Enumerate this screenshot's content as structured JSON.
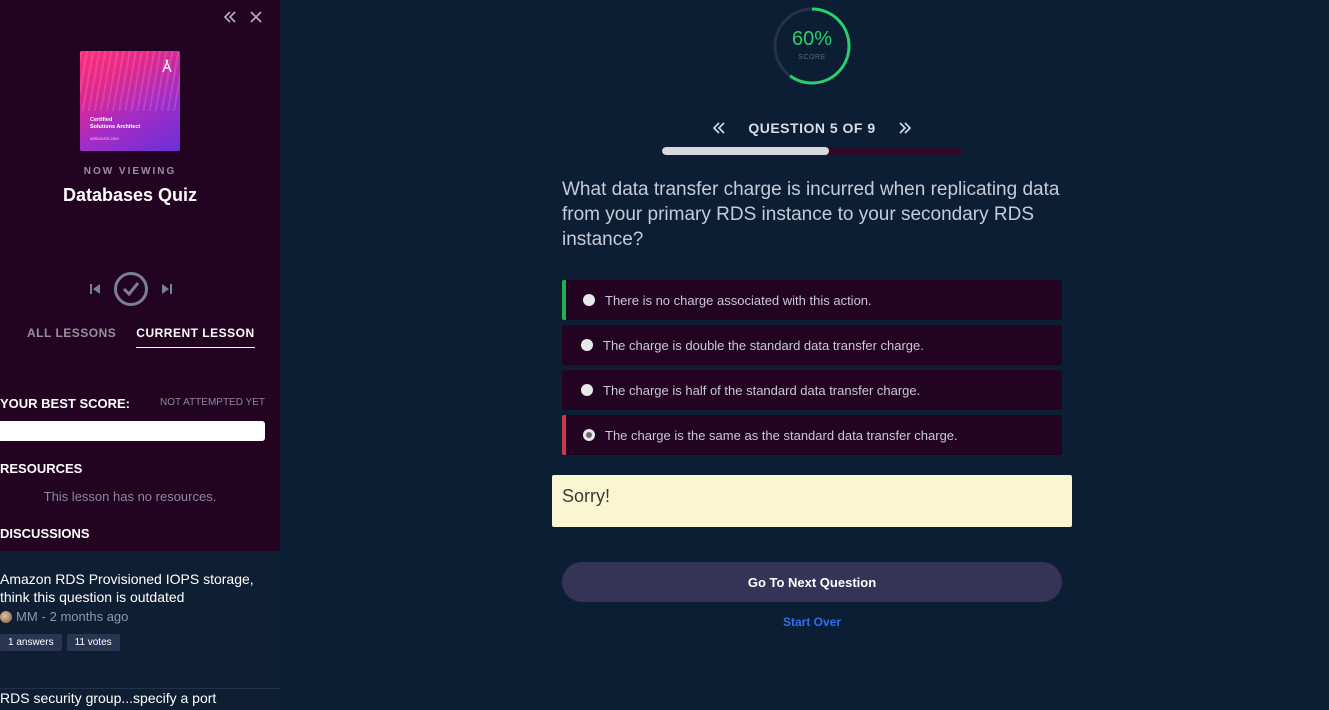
{
  "sidebar": {
    "cover": {
      "title_line1": "Certified",
      "title_line2": "Solutions Architect",
      "subtitle": "ASSOCIATE 2019"
    },
    "now_viewing_label": "NOW VIEWING",
    "lesson_title": "Databases Quiz",
    "tabs": [
      {
        "label": "ALL LESSONS",
        "active": false
      },
      {
        "label": "CURRENT LESSON",
        "active": true
      }
    ],
    "best_score_label": "YOUR BEST SCORE:",
    "best_score_value": "NOT ATTEMPTED YET",
    "resources_label": "RESOURCES",
    "resources_empty": "This lesson has no resources.",
    "discussions_label": "DISCUSSIONS",
    "discussions": [
      {
        "title": "Amazon RDS Provisioned IOPS storage, think this question is outdated",
        "author": "MM",
        "time": "- 2 months ago",
        "answers": "1 answers",
        "votes": "11 votes"
      },
      {
        "title": "RDS security group...specify a port"
      }
    ]
  },
  "main": {
    "score": {
      "value": "60%",
      "label": "SCORE",
      "fraction": 0.6
    },
    "question_nav": {
      "label": "QUESTION 5 OF 9",
      "progress": 0.555
    },
    "question": "What data transfer charge is incurred when replicating data from your primary RDS instance to your secondary RDS instance?",
    "options": [
      {
        "text": "There is no charge associated with this action.",
        "state": "correct",
        "selected": false
      },
      {
        "text": "The charge is double the standard data transfer charge.",
        "state": "none",
        "selected": false
      },
      {
        "text": "The charge is half of the standard data transfer charge.",
        "state": "none",
        "selected": false
      },
      {
        "text": "The charge is the same as the standard data transfer charge.",
        "state": "wrong",
        "selected": true
      }
    ],
    "feedback": "Sorry!",
    "next_button": "Go To Next Question",
    "start_over": "Start Over"
  },
  "colors": {
    "sidebar_bg": "#230322",
    "main_bg": "#0c1e33",
    "score_green": "#2ad06a",
    "correct": "#1fb04f",
    "wrong": "#c93a46",
    "feedback_bg": "#fbf6d2",
    "link": "#2f6ff0"
  }
}
